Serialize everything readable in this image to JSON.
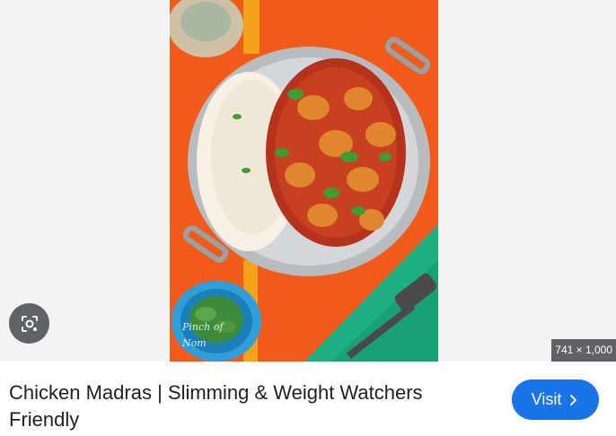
{
  "preview": {
    "image_subject": "chicken-madras-photo",
    "dimensions": "741 × 1,000",
    "watermark": "Pinch of Nom"
  },
  "result": {
    "title": "Chicken Madras | Slimming & Weight Watchers Friendly"
  },
  "visit": {
    "label": "Visit",
    "icon": "chevron-right-icon"
  },
  "lens": {
    "icon": "google-lens-icon"
  },
  "colors": {
    "accent": "#1a73e8",
    "overlay_gray": "#5f6368",
    "text": "#202124",
    "preview_bg": "#f1f3f4"
  }
}
